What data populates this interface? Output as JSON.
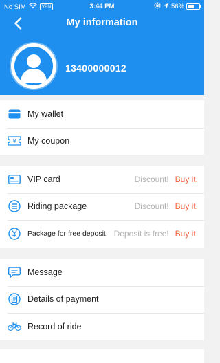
{
  "status_bar": {
    "carrier": "No SIM",
    "vpn": "VPN",
    "time": "3:44 PM",
    "battery": "56%",
    "battery_level": 0.56
  },
  "header": {
    "title": "My information",
    "phone": "13400000012"
  },
  "colors": {
    "primary": "#1e8fee",
    "action": "#f5623e",
    "hint": "#b3b3b3"
  },
  "group1": {
    "wallet": {
      "label": "My wallet",
      "icon": "wallet-icon"
    },
    "coupon": {
      "label": "My coupon",
      "icon": "coupon-icon"
    }
  },
  "group2": {
    "vip": {
      "label": "VIP card",
      "hint": "Discount!",
      "action": "Buy it.",
      "icon": "card-icon"
    },
    "riding": {
      "label": "Riding package",
      "hint": "Discount!",
      "action": "Buy it.",
      "icon": "list-icon"
    },
    "deposit": {
      "label": "Package for free deposit",
      "hint": "Deposit is free!",
      "action": "Buy it.",
      "icon": "yen-icon"
    }
  },
  "group3": {
    "message": {
      "label": "Message",
      "icon": "message-icon"
    },
    "payment": {
      "label": "Details of payment",
      "icon": "receipt-icon"
    },
    "rides": {
      "label": "Record of ride",
      "icon": "bicycle-icon"
    }
  }
}
